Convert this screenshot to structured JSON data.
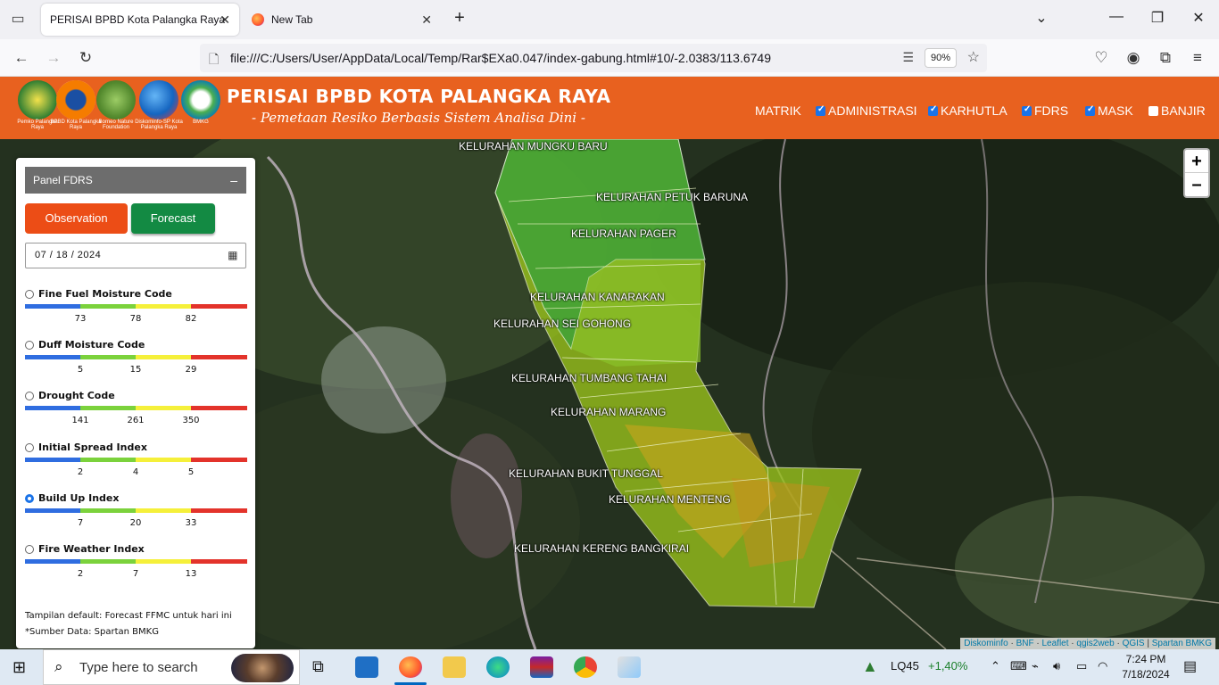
{
  "browser": {
    "tabs": [
      {
        "label": "PERISAI BPBD Kota Palangka Raya",
        "active": true
      },
      {
        "label": "New Tab",
        "active": false
      }
    ],
    "url": "file:///C:/Users/User/AppData/Local/Temp/Rar$EXa0.047/index-gabung.html#10/-2.0383/113.6749",
    "zoom": "90%"
  },
  "header": {
    "title": "PERISAI BPBD KOTA PALANGKA RAYA",
    "subtitle": "- Pemetaan Resiko Berbasis Sistem Analisa Dini -",
    "logos": [
      {
        "caption": "Pemko Palangka Raya",
        "color": "#2e7d32"
      },
      {
        "caption": "BPBD Kota Palangka Raya",
        "color": "#f57c00"
      },
      {
        "caption": "Borneo Nature Foundation",
        "color": "#558b2f"
      },
      {
        "caption": "Diskominfo-SP Kota Palangka Raya",
        "color": "#1565c0"
      },
      {
        "caption": "BMKG",
        "color": "#0277bd"
      }
    ],
    "nav": [
      {
        "label": "MATRIK",
        "checkbox": false
      },
      {
        "label": "ADMINISTRASI",
        "checkbox": true,
        "checked": true
      },
      {
        "label": "KARHUTLA",
        "checkbox": true,
        "checked": true
      },
      {
        "label": "FDRS",
        "checkbox": true,
        "checked": true
      },
      {
        "label": "MASK",
        "checkbox": true,
        "checked": true
      },
      {
        "label": "BANJIR",
        "checkbox": true,
        "checked": false
      }
    ]
  },
  "panel": {
    "title": "Panel FDRS",
    "minimize": "–",
    "observation_label": "Observation",
    "forecast_label": "Forecast",
    "date": "07 / 18 / 2024",
    "scale_colors": [
      "#2f6de0",
      "#7bd23c",
      "#f5f03a",
      "#e3332b"
    ],
    "indices": [
      {
        "name": "Fine Fuel Moisture Code",
        "ticks": [
          "73",
          "78",
          "82"
        ],
        "selected": false
      },
      {
        "name": "Duff Moisture Code",
        "ticks": [
          "5",
          "15",
          "29"
        ],
        "selected": false
      },
      {
        "name": "Drought Code",
        "ticks": [
          "141",
          "261",
          "350"
        ],
        "selected": false
      },
      {
        "name": "Initial Spread Index",
        "ticks": [
          "2",
          "4",
          "5"
        ],
        "selected": false
      },
      {
        "name": "Build Up Index",
        "ticks": [
          "7",
          "20",
          "33"
        ],
        "selected": true
      },
      {
        "name": "Fire Weather Index",
        "ticks": [
          "2",
          "7",
          "13"
        ],
        "selected": false
      }
    ],
    "note_default": "Tampilan default: Forecast FFMC untuk hari ini",
    "note_source": "*Sumber Data: Spartan BMKG"
  },
  "map": {
    "kelurahan_labels": [
      "KELURAHAN MUNGKU BARU",
      "KELURAHAN PETUK BARUNA",
      "KELURAHAN PAGER",
      "KELURAHAN KANARAKAN",
      "KELURAHAN SEI GOHONG",
      "KELURAHAN TUMBANG TAHAI",
      "KELURAHAN MARANG",
      "KELURAHAN BUKIT TUNGGAL",
      "KELURAHAN MENTENG",
      "KELURAHAN KERENG BANGKIRAI"
    ],
    "zoom_in": "+",
    "zoom_out": "–",
    "attribution": [
      "Diskominfo",
      "BNF",
      "Leaflet",
      "qgis2web",
      "QGIS",
      "Spartan BMKG"
    ]
  },
  "taskbar": {
    "search_placeholder": "Type here to search",
    "stock_name": "LQ45",
    "stock_change": "+1,40%",
    "time": "7:24 PM",
    "date": "7/18/2024"
  }
}
